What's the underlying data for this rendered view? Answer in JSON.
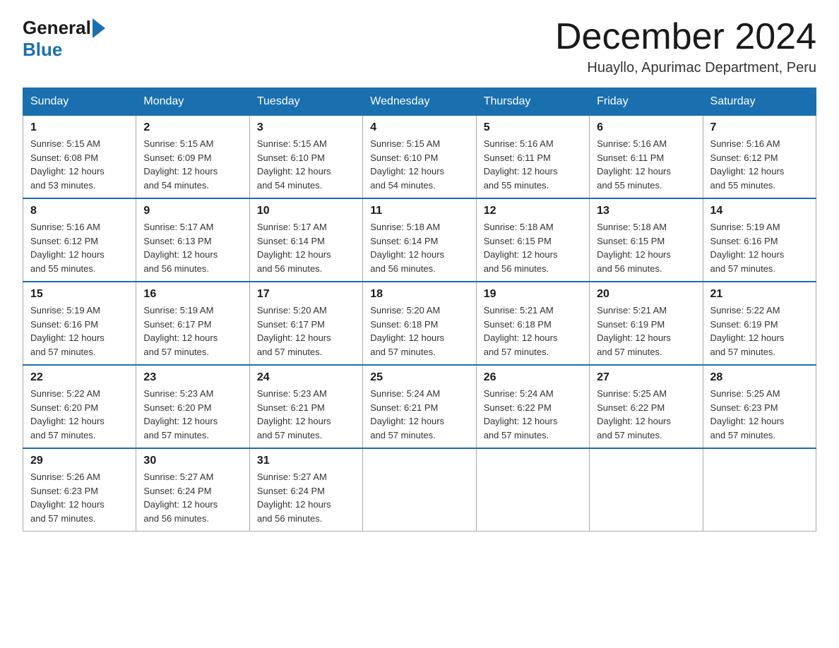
{
  "header": {
    "logo_general": "General",
    "logo_blue": "Blue",
    "month_title": "December 2024",
    "location": "Huayllo, Apurimac Department, Peru"
  },
  "days_of_week": [
    "Sunday",
    "Monday",
    "Tuesday",
    "Wednesday",
    "Thursday",
    "Friday",
    "Saturday"
  ],
  "weeks": [
    [
      {
        "day": "1",
        "sunrise": "5:15 AM",
        "sunset": "6:08 PM",
        "daylight": "12 hours and 53 minutes."
      },
      {
        "day": "2",
        "sunrise": "5:15 AM",
        "sunset": "6:09 PM",
        "daylight": "12 hours and 54 minutes."
      },
      {
        "day": "3",
        "sunrise": "5:15 AM",
        "sunset": "6:10 PM",
        "daylight": "12 hours and 54 minutes."
      },
      {
        "day": "4",
        "sunrise": "5:15 AM",
        "sunset": "6:10 PM",
        "daylight": "12 hours and 54 minutes."
      },
      {
        "day": "5",
        "sunrise": "5:16 AM",
        "sunset": "6:11 PM",
        "daylight": "12 hours and 55 minutes."
      },
      {
        "day": "6",
        "sunrise": "5:16 AM",
        "sunset": "6:11 PM",
        "daylight": "12 hours and 55 minutes."
      },
      {
        "day": "7",
        "sunrise": "5:16 AM",
        "sunset": "6:12 PM",
        "daylight": "12 hours and 55 minutes."
      }
    ],
    [
      {
        "day": "8",
        "sunrise": "5:16 AM",
        "sunset": "6:12 PM",
        "daylight": "12 hours and 55 minutes."
      },
      {
        "day": "9",
        "sunrise": "5:17 AM",
        "sunset": "6:13 PM",
        "daylight": "12 hours and 56 minutes."
      },
      {
        "day": "10",
        "sunrise": "5:17 AM",
        "sunset": "6:14 PM",
        "daylight": "12 hours and 56 minutes."
      },
      {
        "day": "11",
        "sunrise": "5:18 AM",
        "sunset": "6:14 PM",
        "daylight": "12 hours and 56 minutes."
      },
      {
        "day": "12",
        "sunrise": "5:18 AM",
        "sunset": "6:15 PM",
        "daylight": "12 hours and 56 minutes."
      },
      {
        "day": "13",
        "sunrise": "5:18 AM",
        "sunset": "6:15 PM",
        "daylight": "12 hours and 56 minutes."
      },
      {
        "day": "14",
        "sunrise": "5:19 AM",
        "sunset": "6:16 PM",
        "daylight": "12 hours and 57 minutes."
      }
    ],
    [
      {
        "day": "15",
        "sunrise": "5:19 AM",
        "sunset": "6:16 PM",
        "daylight": "12 hours and 57 minutes."
      },
      {
        "day": "16",
        "sunrise": "5:19 AM",
        "sunset": "6:17 PM",
        "daylight": "12 hours and 57 minutes."
      },
      {
        "day": "17",
        "sunrise": "5:20 AM",
        "sunset": "6:17 PM",
        "daylight": "12 hours and 57 minutes."
      },
      {
        "day": "18",
        "sunrise": "5:20 AM",
        "sunset": "6:18 PM",
        "daylight": "12 hours and 57 minutes."
      },
      {
        "day": "19",
        "sunrise": "5:21 AM",
        "sunset": "6:18 PM",
        "daylight": "12 hours and 57 minutes."
      },
      {
        "day": "20",
        "sunrise": "5:21 AM",
        "sunset": "6:19 PM",
        "daylight": "12 hours and 57 minutes."
      },
      {
        "day": "21",
        "sunrise": "5:22 AM",
        "sunset": "6:19 PM",
        "daylight": "12 hours and 57 minutes."
      }
    ],
    [
      {
        "day": "22",
        "sunrise": "5:22 AM",
        "sunset": "6:20 PM",
        "daylight": "12 hours and 57 minutes."
      },
      {
        "day": "23",
        "sunrise": "5:23 AM",
        "sunset": "6:20 PM",
        "daylight": "12 hours and 57 minutes."
      },
      {
        "day": "24",
        "sunrise": "5:23 AM",
        "sunset": "6:21 PM",
        "daylight": "12 hours and 57 minutes."
      },
      {
        "day": "25",
        "sunrise": "5:24 AM",
        "sunset": "6:21 PM",
        "daylight": "12 hours and 57 minutes."
      },
      {
        "day": "26",
        "sunrise": "5:24 AM",
        "sunset": "6:22 PM",
        "daylight": "12 hours and 57 minutes."
      },
      {
        "day": "27",
        "sunrise": "5:25 AM",
        "sunset": "6:22 PM",
        "daylight": "12 hours and 57 minutes."
      },
      {
        "day": "28",
        "sunrise": "5:25 AM",
        "sunset": "6:23 PM",
        "daylight": "12 hours and 57 minutes."
      }
    ],
    [
      {
        "day": "29",
        "sunrise": "5:26 AM",
        "sunset": "6:23 PM",
        "daylight": "12 hours and 57 minutes."
      },
      {
        "day": "30",
        "sunrise": "5:27 AM",
        "sunset": "6:24 PM",
        "daylight": "12 hours and 56 minutes."
      },
      {
        "day": "31",
        "sunrise": "5:27 AM",
        "sunset": "6:24 PM",
        "daylight": "12 hours and 56 minutes."
      },
      null,
      null,
      null,
      null
    ]
  ],
  "labels": {
    "sunrise": "Sunrise:",
    "sunset": "Sunset:",
    "daylight": "Daylight:"
  }
}
